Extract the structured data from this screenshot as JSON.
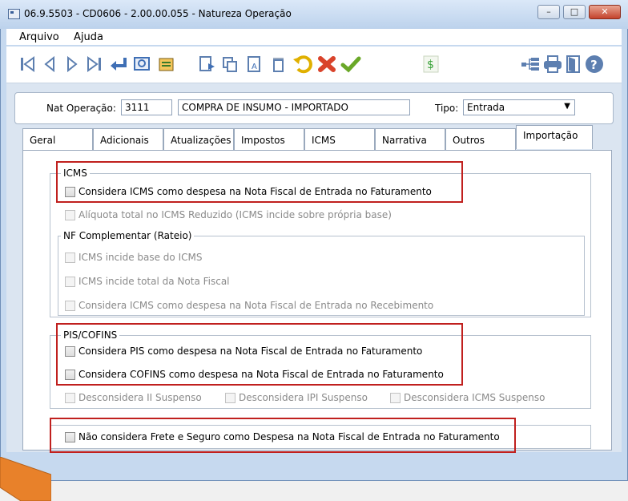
{
  "window": {
    "title": "06.9.5503 - CD0606 - 2.00.00.055 - Natureza Operação",
    "minimize": "–",
    "restore": "□",
    "close": "✕"
  },
  "menu": {
    "items": [
      "Arquivo",
      "Ajuda"
    ]
  },
  "toolbar": {
    "icons": [
      "first-record-icon",
      "previous-record-icon",
      "next-record-icon",
      "last-record-icon",
      "goto-icon",
      "search-icon",
      "list-icon",
      "add-icon",
      "copy-icon",
      "edit-icon",
      "delete-icon",
      "undo-icon",
      "cancel-icon",
      "confirm-icon",
      "currency-icon",
      "tree-icon",
      "print-icon",
      "exit-icon",
      "help-icon"
    ]
  },
  "header": {
    "nat_label": "Nat Operação:",
    "nat_code": "3111",
    "nat_desc": "COMPRA DE INSUMO - IMPORTADO",
    "tipo_label": "Tipo:",
    "tipo_value": "Entrada"
  },
  "tabs": [
    "Geral",
    "Adicionais",
    "Atualizações",
    "Impostos",
    "ICMS",
    "Narrativa",
    "Outros",
    "Importação"
  ],
  "active_tab": "Importação",
  "icms_group": {
    "title": "ICMS",
    "opt1": "Considera ICMS como despesa na Nota Fiscal de Entrada no Faturamento",
    "opt2": "Alíquota total no ICMS Reduzido (ICMS incide sobre própria base)"
  },
  "nf_group": {
    "title": "NF Complementar (Rateio)",
    "opt1": "ICMS incide base do ICMS",
    "opt2": "ICMS incide total da Nota Fiscal",
    "opt3": "Considera ICMS como despesa na Nota Fiscal de Entrada no Recebimento"
  },
  "pis_group": {
    "title": "PIS/COFINS",
    "opt1": "Considera PIS como despesa na Nota Fiscal de Entrada no Faturamento",
    "opt2": "Considera COFINS como despesa na Nota Fiscal de Entrada no Faturamento",
    "opt3": "Desconsidera II Suspenso",
    "opt4": "Desconsidera IPI Suspenso",
    "opt5": "Desconsidera ICMS Suspenso"
  },
  "frete": {
    "opt1": "Não considera Frete e Seguro como Despesa na Nota Fiscal de Entrada no Faturamento"
  },
  "colors": {
    "highlight": "#c0201e",
    "accent": "#e8812a"
  }
}
